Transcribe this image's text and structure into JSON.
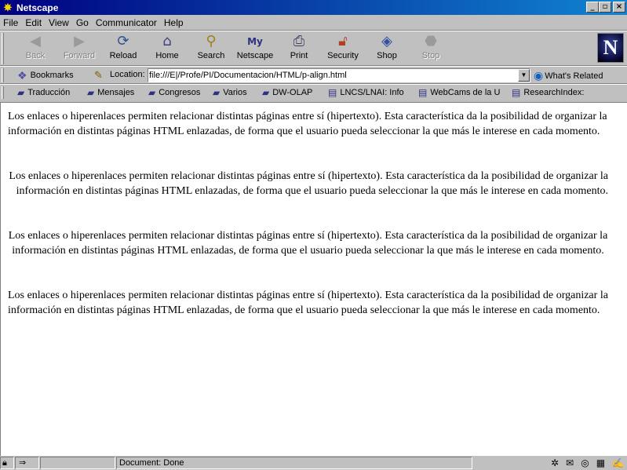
{
  "window": {
    "title": "Netscape",
    "minimize": "_",
    "maximize": "▫",
    "close": "×"
  },
  "menu": [
    "File",
    "Edit",
    "View",
    "Go",
    "Communicator",
    "Help"
  ],
  "nav": {
    "back": "Back",
    "forward": "Forward",
    "reload": "Reload",
    "home": "Home",
    "search": "Search",
    "netscape": "Netscape",
    "print": "Print",
    "security": "Security",
    "shop": "Shop",
    "stop": "Stop"
  },
  "location": {
    "bookmarks_label": "Bookmarks",
    "label": "Location:",
    "url": "file:///E|/Profe/PI/Documentacion/HTML/p-align.html",
    "related_label": "What's Related"
  },
  "personal_toolbar": [
    "Traducción",
    "Mensajes",
    "Congresos",
    "Varios",
    "DW-OLAP",
    "LNCS/LNAI: Info",
    "WebCams de la U",
    "ResearchIndex:"
  ],
  "content": {
    "paragraph_text": "Los enlaces o hiperenlaces permiten relacionar distintas páginas entre sí (hipertexto). Esta característica da la posibilidad de organizar la información en distintas páginas HTML enlazadas, de forma que el usuario pueda seleccionar la que más le interese en cada momento.",
    "p1": "Los enlaces o hiperenlaces permiten relacionar distintas páginas entre sí (hipertexto). Esta característica da la posibilidad de organizar la información en distintas páginas HTML enlazadas, de forma que el usuario pueda seleccionar la que más le interese en cada momento.",
    "p2": "Los enlaces o hiperenlaces permiten relacionar distintas páginas entre sí (hipertexto). Esta característica da la posibilidad de organizar la información en distintas páginas HTML enlazadas, de forma que el usuario pueda seleccionar la que más le interese en cada momento.",
    "p3": "Los enlaces o hiperenlaces permiten relacionar distintas páginas entre sí (hipertexto). Esta característica da la posibilidad de organizar la información en distintas páginas HTML enlazadas, de forma que el usuario pueda seleccionar la que más le interese en cada momento.",
    "p4": "Los enlaces o hiperenlaces permiten relacionar distintas páginas entre sí (hipertexto). Esta característica da la posibilidad de organizar la información en distintas páginas HTML enlazadas, de forma que el usuario pueda seleccionar la que más le interese en cada momento."
  },
  "status": {
    "text": "Document: Done"
  },
  "icons": {
    "back": "back-arrow-icon",
    "forward": "forward-arrow-icon",
    "reload": "reload-icon",
    "home": "home-icon",
    "search": "search-icon",
    "netscape": "my-netscape-icon",
    "print": "printer-icon",
    "security": "padlock-icon",
    "shop": "shopping-bag-icon",
    "stop": "stop-icon"
  },
  "colors": {
    "titlebar_start": "#000080",
    "titlebar_end": "#1084d0",
    "chrome": "#c0c0c0"
  }
}
